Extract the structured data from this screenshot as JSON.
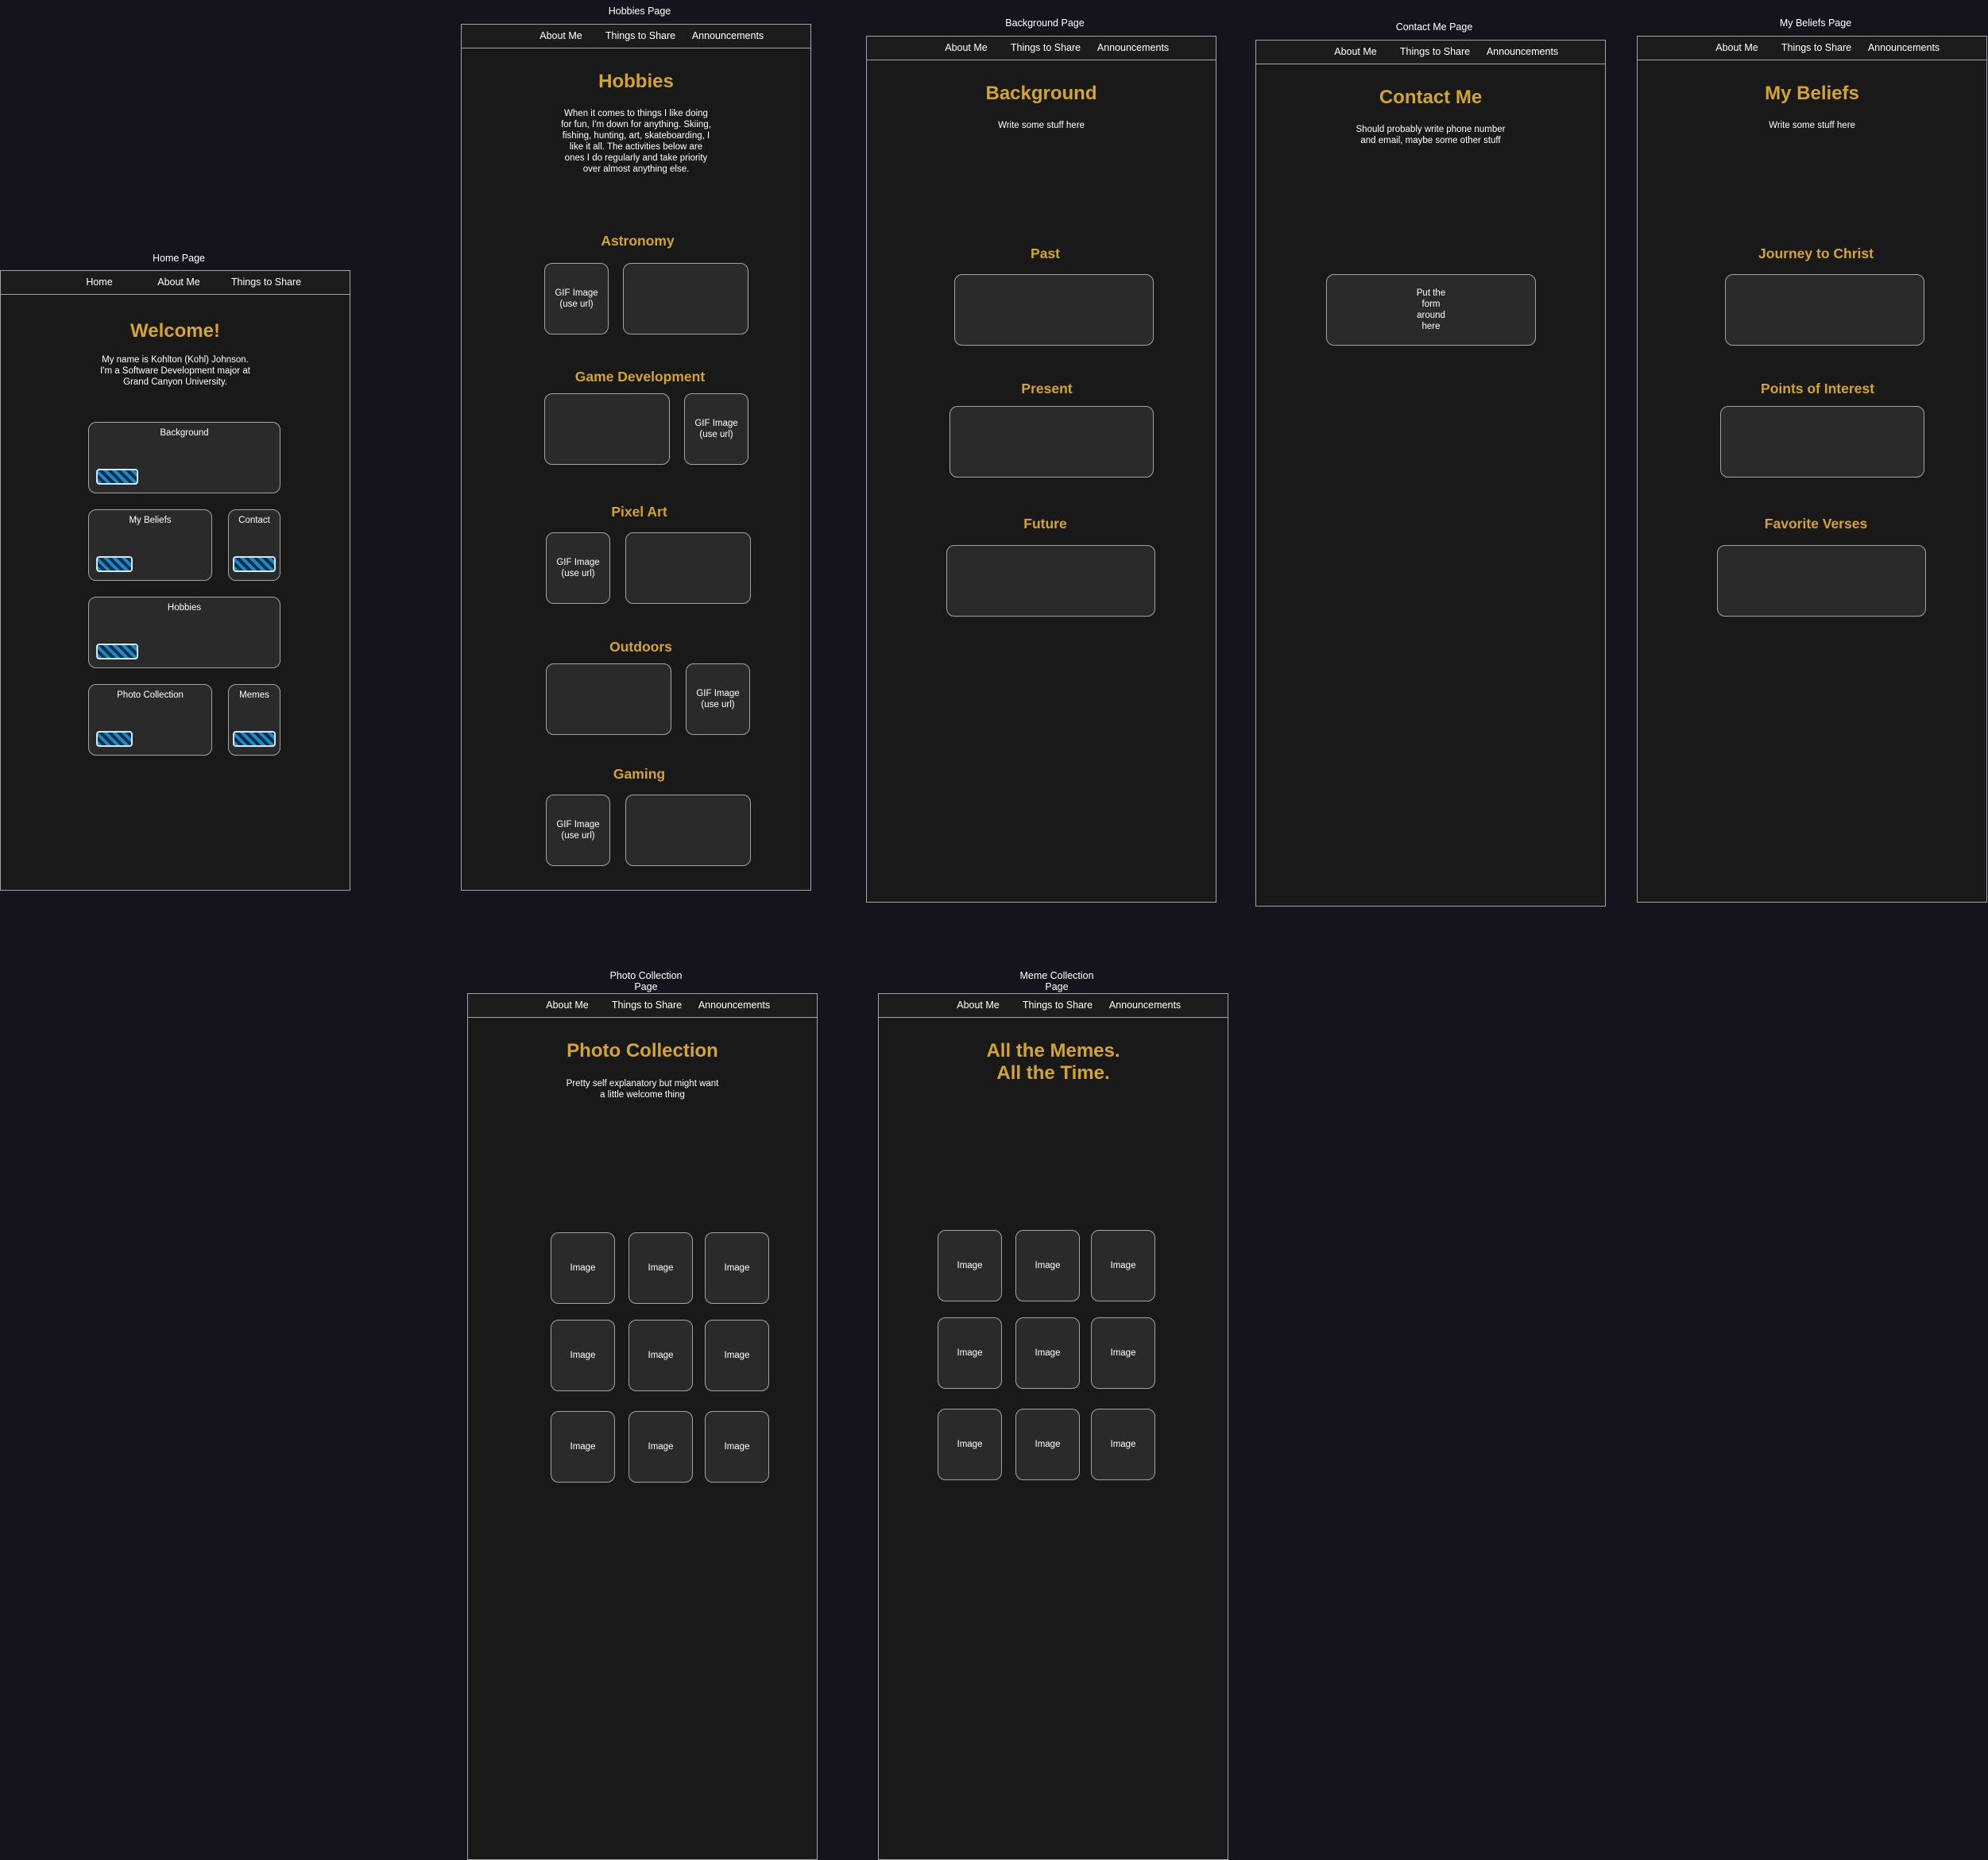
{
  "home": {
    "frame_label": "Home Page",
    "nav": [
      "Home",
      "About Me",
      "Things to Share"
    ],
    "title": "Welcome!",
    "intro": [
      "My name is Kohlton (Kohl) Johnson.",
      "I'm a Software Development major at",
      "Grand Canyon University."
    ],
    "cards": {
      "background": "Background",
      "beliefs": "My Beliefs",
      "contact": "Contact",
      "hobbies": "Hobbies",
      "photos": "Photo Collection",
      "memes": "Memes"
    }
  },
  "hobbies": {
    "frame_label": "Hobbies Page",
    "nav": [
      "About Me",
      "Things to Share",
      "Announcements"
    ],
    "title": "Hobbies",
    "intro": [
      "When it comes to things I like doing",
      "for fun, I'm down for anything. Skiing,",
      "fishing, hunting, art, skateboarding, I",
      "like it all. The activities below are",
      "ones I do regularly and take priority",
      "over almost anything else."
    ],
    "sections": [
      "Astronomy",
      "Game Development",
      "Pixel Art",
      "Outdoors",
      "Gaming"
    ],
    "gif_label": [
      "GIF Image",
      "(use url)"
    ]
  },
  "background": {
    "frame_label": "Background Page",
    "nav": [
      "About Me",
      "Things to Share",
      "Announcements"
    ],
    "title": "Background",
    "intro": "Write some stuff here",
    "sections": [
      "Past",
      "Present",
      "Future"
    ]
  },
  "contact": {
    "frame_label": "Contact Me Page",
    "nav": [
      "About Me",
      "Things to Share",
      "Announcements"
    ],
    "title": "Contact Me",
    "intro": [
      "Should probably write phone number",
      "and email, maybe some other stuff"
    ],
    "form_placeholder": [
      "Put the",
      "form",
      "around",
      "here"
    ]
  },
  "beliefs": {
    "frame_label": "My Beliefs Page",
    "nav": [
      "About Me",
      "Things to Share",
      "Announcements"
    ],
    "title": "My Beliefs",
    "intro": "Write some stuff here",
    "sections": [
      "Journey to Christ",
      "Points of Interest",
      "Favorite Verses"
    ]
  },
  "photos": {
    "frame_label": [
      "Photo Collection",
      "Page"
    ],
    "nav": [
      "About Me",
      "Things to Share",
      "Announcements"
    ],
    "title": "Photo Collection",
    "intro": [
      "Pretty self explanatory but might want",
      "a little welcome thing"
    ],
    "image_label": "Image"
  },
  "memes": {
    "frame_label": [
      "Meme Collection",
      "Page"
    ],
    "nav": [
      "About Me",
      "Things to Share",
      "Announcements"
    ],
    "title": [
      "All the Memes.",
      "All the Time."
    ],
    "image_label": "Image"
  }
}
